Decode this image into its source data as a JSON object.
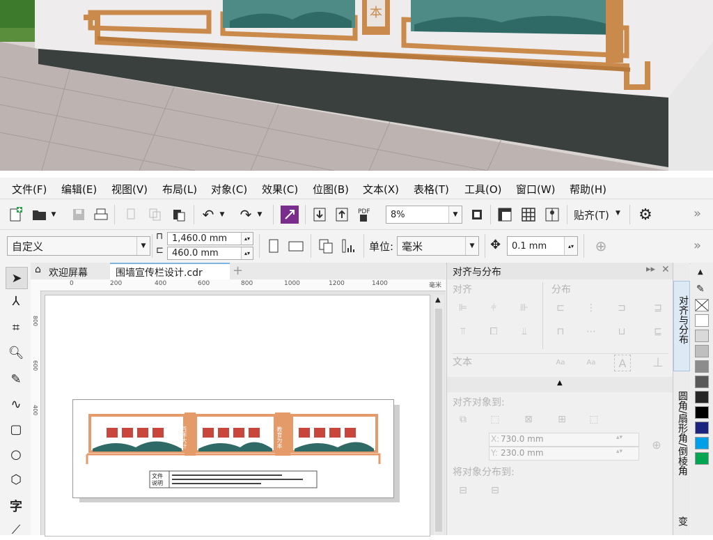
{
  "photo": {
    "board_character": "本"
  },
  "menubar": {
    "items": [
      "文件(F)",
      "编辑(E)",
      "视图(V)",
      "布局(L)",
      "对象(C)",
      "效果(C)",
      "位图(B)",
      "文本(X)",
      "表格(T)",
      "工具(O)",
      "窗口(W)",
      "帮助(H)"
    ]
  },
  "toolbar1": {
    "zoom_value": "8%",
    "paste_label": "贴齐(T)",
    "overflow": "»"
  },
  "toolbar2": {
    "page_preset": "自定义",
    "width_value": "1,460.0 mm",
    "height_value": "460.0 mm",
    "unit_label": "单位:",
    "unit_value": "毫米",
    "nudge_value": "0.1 mm",
    "overflow": "»"
  },
  "tabs": {
    "welcome": "欢迎屏幕",
    "document": "围墙宣传栏设计.cdr",
    "add": "+"
  },
  "ruler": {
    "ticks": [
      "0",
      "200",
      "400",
      "600",
      "800",
      "1000",
      "1200",
      "1400"
    ],
    "unit": "毫米",
    "v_ticks": [
      "800",
      "600",
      "400"
    ]
  },
  "artwork": {
    "panel_labels": [
      "百年大计",
      "教育为本"
    ],
    "note_label_1": "文件",
    "note_label_2": "说明"
  },
  "panel": {
    "title": "对齐与分布",
    "align_label": "对齐",
    "distribute_label": "分布",
    "text_label": "文本",
    "align_to_label": "对齐对象到:",
    "x_label": "X:",
    "x_value": "730.0 mm",
    "y_label": "Y:",
    "y_value": "230.0 mm",
    "distribute_to_label": "将对象分布到:",
    "text_icon_1": "Aa",
    "text_icon_2": "Aa",
    "text_icon_3": "A"
  },
  "sidetabs": {
    "tab1": "对齐与分布",
    "tab2": "圆角/扇形角/倒棱角",
    "tab3": "变"
  },
  "palette": {
    "colors": [
      "#ffffff",
      "#d9d9d9",
      "#bfbfbf",
      "#8c8c8c",
      "#595959",
      "#262626",
      "#000000",
      "#1a237e",
      "#00a0e9",
      "#00a651"
    ]
  }
}
